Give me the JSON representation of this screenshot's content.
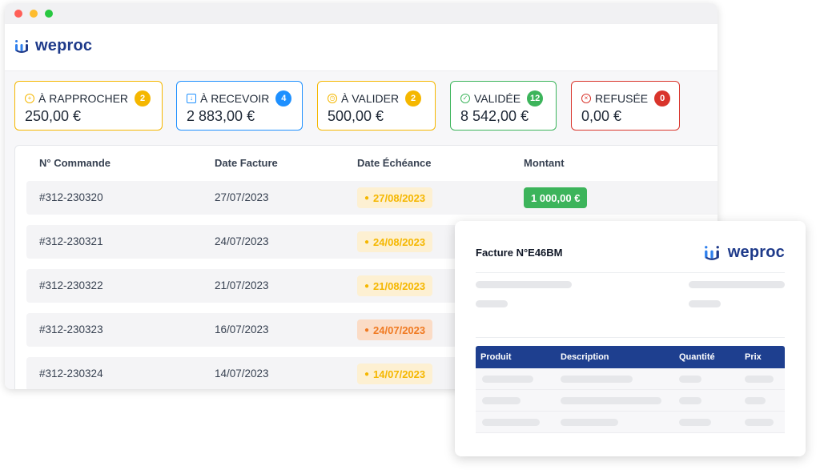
{
  "app": {
    "logo_text": "weproc"
  },
  "colors": {
    "brand": "#1e3a8a",
    "rapprocher": "#f5b700",
    "recevoir": "#1e90ff",
    "valider": "#f5b700",
    "validee": "#3cb45b",
    "refusee": "#d9342b"
  },
  "status_cards": [
    {
      "label": "À RAPPROCHER",
      "count": "2",
      "amount": "250,00 €",
      "icon": "plus-circle-icon"
    },
    {
      "label": "À RECEVOIR",
      "count": "4",
      "amount": "2 883,00 €",
      "icon": "inbox-icon"
    },
    {
      "label": "À VALIDER",
      "count": "2",
      "amount": "500,00 €",
      "icon": "clock-icon"
    },
    {
      "label": "VALIDÉE",
      "count": "12",
      "amount": "8 542,00 €",
      "icon": "check-circle-icon"
    },
    {
      "label": "REFUSÉE",
      "count": "0",
      "amount": "0,00 €",
      "icon": "x-circle-icon"
    }
  ],
  "table": {
    "headers": [
      "N° Commande",
      "Date Facture",
      "Date Échéance",
      "Montant"
    ],
    "rows": [
      {
        "order": "#312-230320",
        "invoice_date": "27/07/2023",
        "due_date": "27/08/2023",
        "amount": "1 000,00 €"
      },
      {
        "order": "#312-230321",
        "invoice_date": "24/07/2023",
        "due_date": "24/08/2023"
      },
      {
        "order": "#312-230322",
        "invoice_date": "21/07/2023",
        "due_date": "21/08/2023"
      },
      {
        "order": "#312-230323",
        "invoice_date": "16/07/2023",
        "due_date": "24/07/2023"
      },
      {
        "order": "#312-230324",
        "invoice_date": "14/07/2023",
        "due_date": "14/07/2023"
      }
    ]
  },
  "invoice": {
    "title": "Facture N°E46BM",
    "logo_text": "weproc",
    "headers": [
      "Produit",
      "Description",
      "Quantité",
      "Prix"
    ]
  }
}
